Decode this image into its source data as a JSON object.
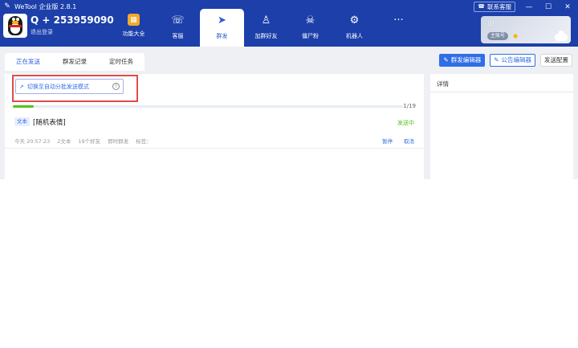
{
  "app": {
    "title": "WeTool 企业版 2.8.1",
    "logo_icon": "wrench-icon"
  },
  "window": {
    "support_label": "联系客服",
    "minimize_glyph": "—",
    "maximize_glyph": "☐",
    "close_glyph": "✕"
  },
  "account": {
    "name": "Q + 253959090",
    "logout": "退出登录",
    "id_label": "ID:",
    "badge": "主账号"
  },
  "nav": [
    {
      "label": "功能大全",
      "icon": "grid-icon"
    },
    {
      "label": "客服",
      "icon": "headset-icon"
    },
    {
      "label": "群发",
      "icon": "paper-plane-icon",
      "active": true
    },
    {
      "label": "加群好友",
      "icon": "add-user-icon"
    },
    {
      "label": "僵尸粉",
      "icon": "skull-icon"
    },
    {
      "label": "机器人",
      "icon": "robot-icon"
    },
    {
      "label": "···",
      "icon": "more-icon"
    }
  ],
  "tabs": [
    {
      "label": "正在发送",
      "active": true
    },
    {
      "label": "群发记录"
    },
    {
      "label": "定时任务"
    }
  ],
  "actions": {
    "mass_editor": "群发编辑器",
    "notice_editor": "公告编辑器",
    "send_config": "发送配置"
  },
  "switch_mode": {
    "label": "切换至自动分批发送模式",
    "help": "?"
  },
  "progress": {
    "text": "1/19",
    "fraction": 0.053
  },
  "message": {
    "type_tag": "文本",
    "content": "[随机表情]",
    "status": "发送中",
    "meta": [
      "今天 20:57:23",
      "2文本",
      "19个好友",
      "即时群发",
      "标签："
    ],
    "pause": "暂停",
    "cancel": "取消"
  },
  "side": {
    "title": "详情"
  },
  "colors": {
    "header": "#1c3faa",
    "accent": "#2f6ee6",
    "success": "#52c41a",
    "highlight": "#e24a4a"
  }
}
